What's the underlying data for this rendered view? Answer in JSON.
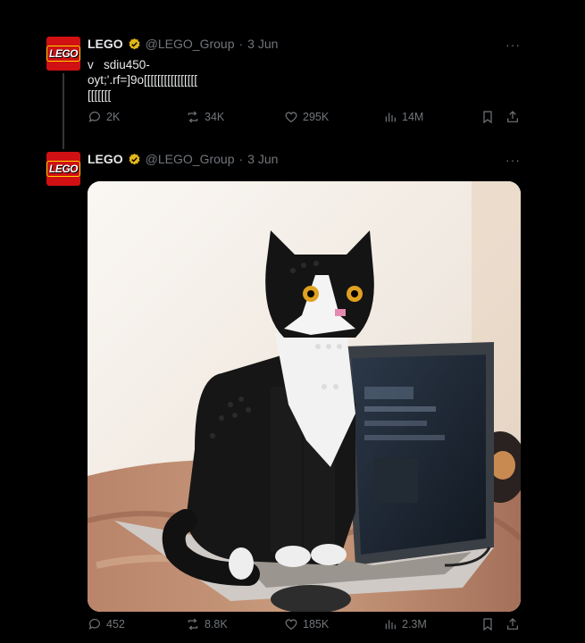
{
  "tweets": [
    {
      "author": "LEGO",
      "handle": "@LEGO_Group",
      "separator": "·",
      "date": "3 Jun",
      "more": "···",
      "text": "v   sdiu450-\noyt;'.rf=]9o[[[[[[[[[[[[[[[[\n[[[[[[[",
      "stats": {
        "replies": "2K",
        "reposts": "34K",
        "likes": "295K",
        "views": "14M"
      }
    },
    {
      "author": "LEGO",
      "handle": "@LEGO_Group",
      "separator": "·",
      "date": "3 Jun",
      "more": "···",
      "stats": {
        "replies": "452",
        "reposts": "8.8K",
        "likes": "185K",
        "views": "2.3M"
      }
    }
  ],
  "avatar_text": "LEGO",
  "colors": {
    "background": "#000000",
    "text": "#e7e9ea",
    "muted": "#71767b",
    "verified": "#e2b719",
    "lego_red": "#d01012"
  },
  "icons": [
    "reply-icon",
    "repost-icon",
    "like-icon",
    "views-icon",
    "bookmark-icon",
    "share-icon",
    "verified-badge-icon",
    "more-icon"
  ]
}
